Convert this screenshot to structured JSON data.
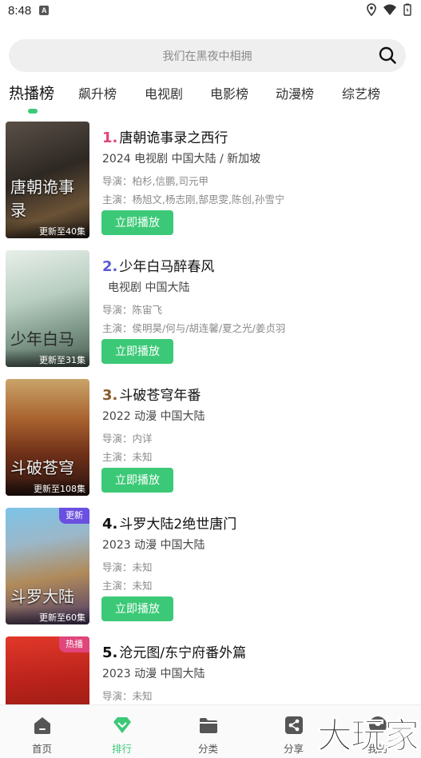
{
  "status_bar": {
    "time": "8:48",
    "notif_icon": "A"
  },
  "search": {
    "placeholder": "我们在黑夜中相拥"
  },
  "tabs": [
    {
      "label": "热播榜",
      "active": true
    },
    {
      "label": "飙升榜"
    },
    {
      "label": "电视剧"
    },
    {
      "label": "电影榜"
    },
    {
      "label": "动漫榜"
    },
    {
      "label": "综艺榜"
    }
  ],
  "items": [
    {
      "rank": "1.",
      "rank_color": "#e0457b",
      "title": "唐朝诡事录之西行",
      "meta": "2024  电视剧  中国大陆 / 新加坡",
      "director": "导演：柏杉,信鹏,司元甲",
      "actors": "主演：杨旭文,杨志刚,郜思雯,陈创,孙雪宁",
      "badge": "更新至40集",
      "poster_text": "唐朝诡事录",
      "play": "立即播放"
    },
    {
      "rank": "2.",
      "rank_color": "#5b5bd6",
      "title": "少年白马醉春风",
      "meta": "电视剧  中国大陆",
      "director": "导演：陈宙飞",
      "actors": "主演：侯明昊/何与/胡连馨/夏之光/姜贞羽",
      "badge": "更新至31集",
      "poster_text": "少年白马",
      "play": "立即播放"
    },
    {
      "rank": "3.",
      "rank_color": "#8a5a2b",
      "title": "斗破苍穹年番",
      "meta": "2022  动漫  中国大陆",
      "director": "导演：内详",
      "actors": "主演：未知",
      "badge": "更新至108集",
      "poster_text": "斗破苍穹",
      "play": "立即播放"
    },
    {
      "rank": "4.",
      "rank_color": "#111111",
      "title": "斗罗大陆2绝世唐门",
      "meta": "2023  动漫  中国大陆",
      "director": "导演：未知",
      "actors": "主演：未知",
      "badge": "更新至60集",
      "tag": "更新",
      "tag_color": "#6a4fe0",
      "poster_text": "斗罗大陆",
      "play": "立即播放"
    },
    {
      "rank": "5.",
      "rank_color": "#111111",
      "title": "沧元图/东宁府番外篇",
      "meta": "2023  动漫  中国大陆",
      "director": "导演：未知",
      "actors": "",
      "badge": "",
      "tag": "热播",
      "tag_color": "#e0457b",
      "poster_text": "",
      "play": ""
    }
  ],
  "bottom_nav": [
    {
      "label": "首页",
      "icon": "home-icon"
    },
    {
      "label": "排行",
      "icon": "diamond-icon",
      "active": true
    },
    {
      "label": "分类",
      "icon": "folder-icon"
    },
    {
      "label": "分享",
      "icon": "share-icon"
    },
    {
      "label": "我的",
      "icon": "user-icon"
    }
  ],
  "watermark": "大玩家",
  "colors": {
    "accent": "#3cc977"
  }
}
